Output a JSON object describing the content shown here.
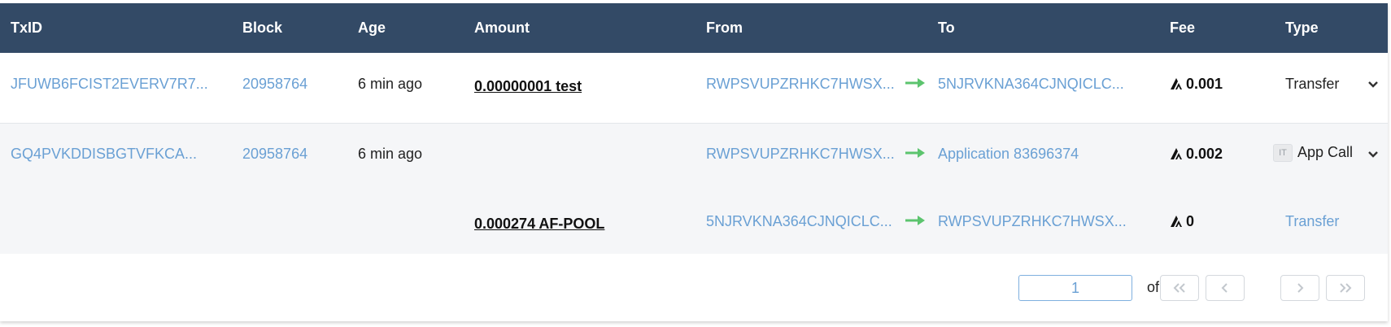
{
  "columns": {
    "txid": "TxID",
    "block": "Block",
    "age": "Age",
    "amount": "Amount",
    "from": "From",
    "to": "To",
    "fee": "Fee",
    "type": "Type"
  },
  "rows": [
    {
      "txid": "JFUWB6FCIST2EVERV7R7...",
      "block": "20958764",
      "age": "6 min ago",
      "amount": "0.00000001 test",
      "from": "RWPSVUPZRHKC7HWSX...",
      "to": "5NJRVKNA364CJNQICLC...",
      "fee": "0.001",
      "type": "Transfer"
    },
    {
      "txid": "GQ4PVKDDISBGTVFKCA...",
      "block": "20958764",
      "age": "6 min ago",
      "amount": "",
      "from": "RWPSVUPZRHKC7HWSX...",
      "to": "Application 83696374",
      "fee": "0.002",
      "type_badge": "IT",
      "type": "App Call",
      "inner": {
        "amount": "0.000274 AF-POOL",
        "from": "5NJRVKNA364CJNQICLC...",
        "to": "RWPSVUPZRHKC7HWSX...",
        "fee": "0",
        "type": "Transfer"
      }
    }
  ],
  "pagination": {
    "current_page": "1",
    "of_label": "of 1"
  },
  "icons": {
    "arrow": "arrow-right-icon",
    "fee": "algorand-icon",
    "expand": "chevron-down-icon",
    "first": "double-chevron-left-icon",
    "prev": "chevron-left-icon",
    "next": "chevron-right-icon",
    "last": "double-chevron-right-icon"
  },
  "colors": {
    "header_bg": "#334a66",
    "link": "#6aa0d4",
    "arrow": "#5cc46e",
    "row_alt_bg": "#f5f6f8"
  }
}
